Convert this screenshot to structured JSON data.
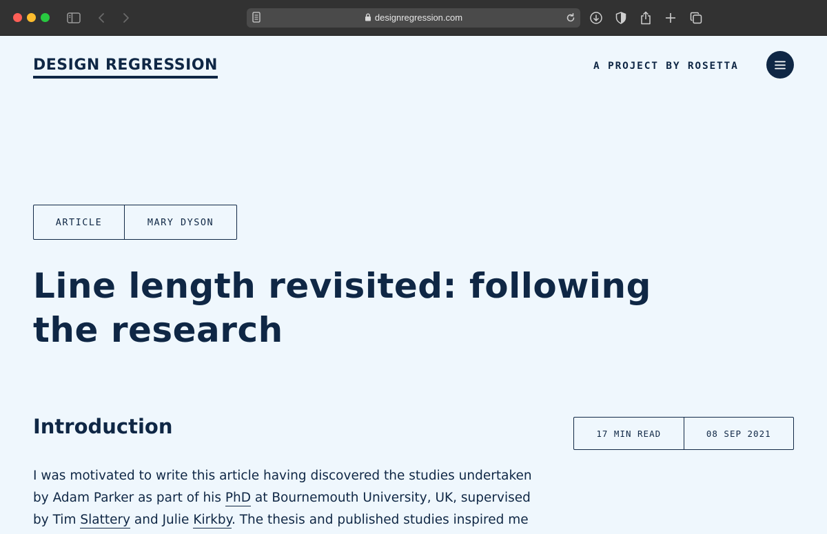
{
  "browser": {
    "url": "designregression.com",
    "icons": [
      "sidebar-icon",
      "back-icon",
      "forward-icon",
      "reader-icon",
      "lock-icon",
      "reload-icon",
      "download-icon",
      "shield-icon",
      "share-icon",
      "new-tab-icon",
      "tabs-icon"
    ]
  },
  "header": {
    "logo": "DESIGN REGRESSION",
    "project": "A PROJECT BY ROSETTA"
  },
  "article": {
    "tags": {
      "type": "ARTICLE",
      "author": "MARY DYSON"
    },
    "title": "Line length revisited: following the research",
    "section_title": "Introduction",
    "meta": {
      "read_time": "17 MIN READ",
      "date": "08 SEP 2021"
    },
    "body": {
      "line1": "I was motivated to write this article having discovered the studies undertaken",
      "line2_a": "by Adam Parker as part of his ",
      "line2_link": "PhD",
      "line2_b": " at Bournemouth University, UK, supervised",
      "line3_a": "by Tim ",
      "line3_link1": "Slattery",
      "line3_b": " and Julie ",
      "line3_link2": "Kirkby",
      "line3_c": ". The thesis and published studies inspired me"
    }
  },
  "colors": {
    "navy": "#0f2745",
    "page_bg": "#eff7fd",
    "chrome_bg": "#323232"
  }
}
